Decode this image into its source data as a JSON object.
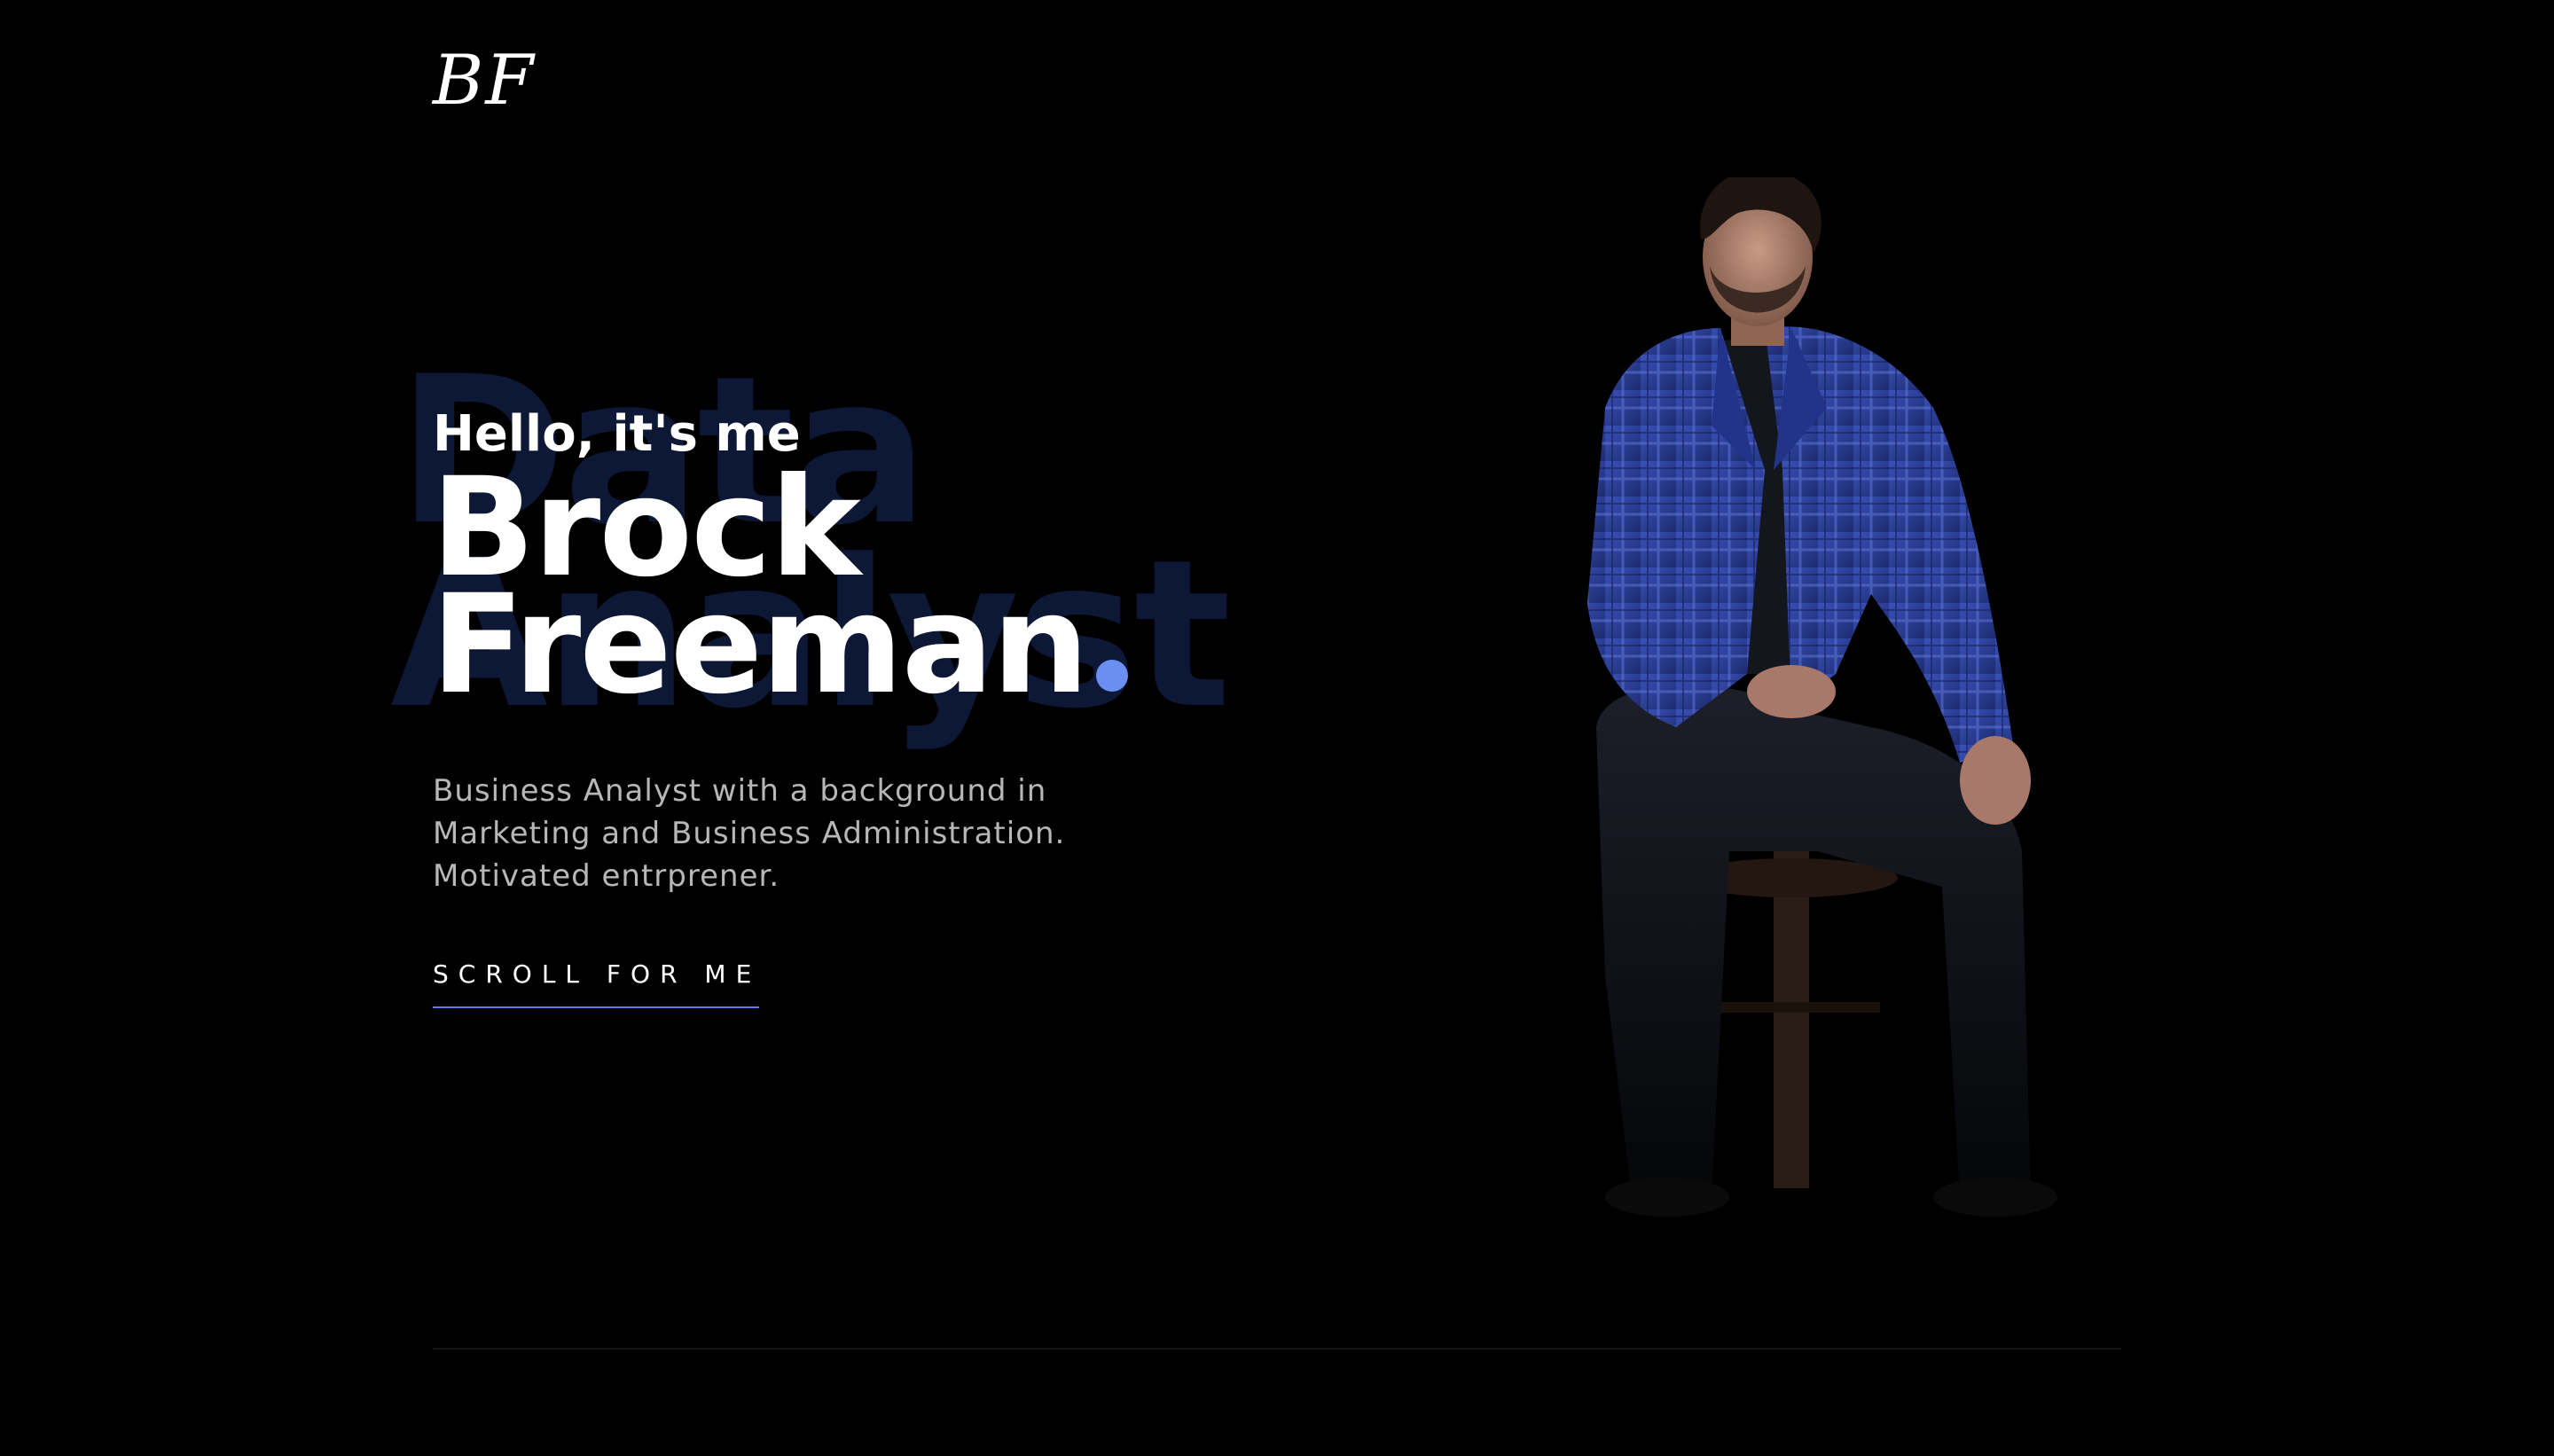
{
  "brand": {
    "logo": "BF"
  },
  "hero": {
    "background_word_1": "Data",
    "background_word_2": "Analyst",
    "greeting": "Hello, it's me",
    "name_first": "Brock",
    "name_last": "Freeman",
    "bio_lines": [
      "Business Analyst with a background in",
      "Marketing and Business Administration.",
      "Motivated entrprener."
    ],
    "scroll_label": "SCROLL FOR ME"
  },
  "colors": {
    "background": "#000000",
    "accent": "#6b8ff0",
    "background_text": "#0d1736",
    "jacket": "#2b3f9a"
  },
  "portrait": {
    "alt": "man in blue plaid jacket sitting on stool"
  }
}
